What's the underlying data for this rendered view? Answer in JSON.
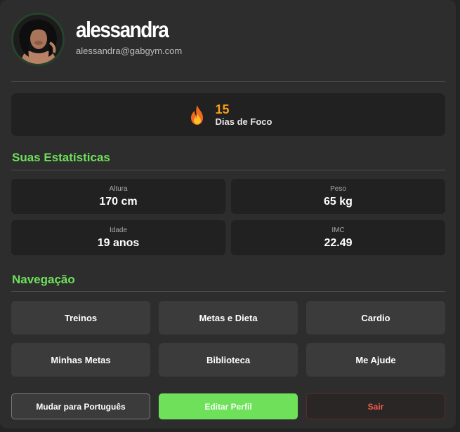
{
  "profile": {
    "name": "alessandra",
    "email": "alessandra@gabgym.com"
  },
  "streak": {
    "count": "15",
    "label": "Dias de Foco"
  },
  "stats": {
    "title": "Suas Estatísticas",
    "height": {
      "label": "Altura",
      "value": "170 cm"
    },
    "weight": {
      "label": "Peso",
      "value": "65 kg"
    },
    "age": {
      "label": "Idade",
      "value": "19 anos"
    },
    "bmi": {
      "label": "IMC",
      "value": "22.49"
    }
  },
  "navigation": {
    "title": "Navegação",
    "items": [
      "Treinos",
      "Metas e Dieta",
      "Cardio",
      "Minhas Metas",
      "Biblioteca",
      "Me Ajude"
    ]
  },
  "actions": {
    "language": "Mudar para Português",
    "edit": "Editar Perfil",
    "logout": "Sair"
  },
  "colors": {
    "accent": "#6ee05a",
    "streak": "#f59e1b",
    "danger": "#f05a4a",
    "card": "#2d2d2d",
    "tile": "#212121"
  }
}
